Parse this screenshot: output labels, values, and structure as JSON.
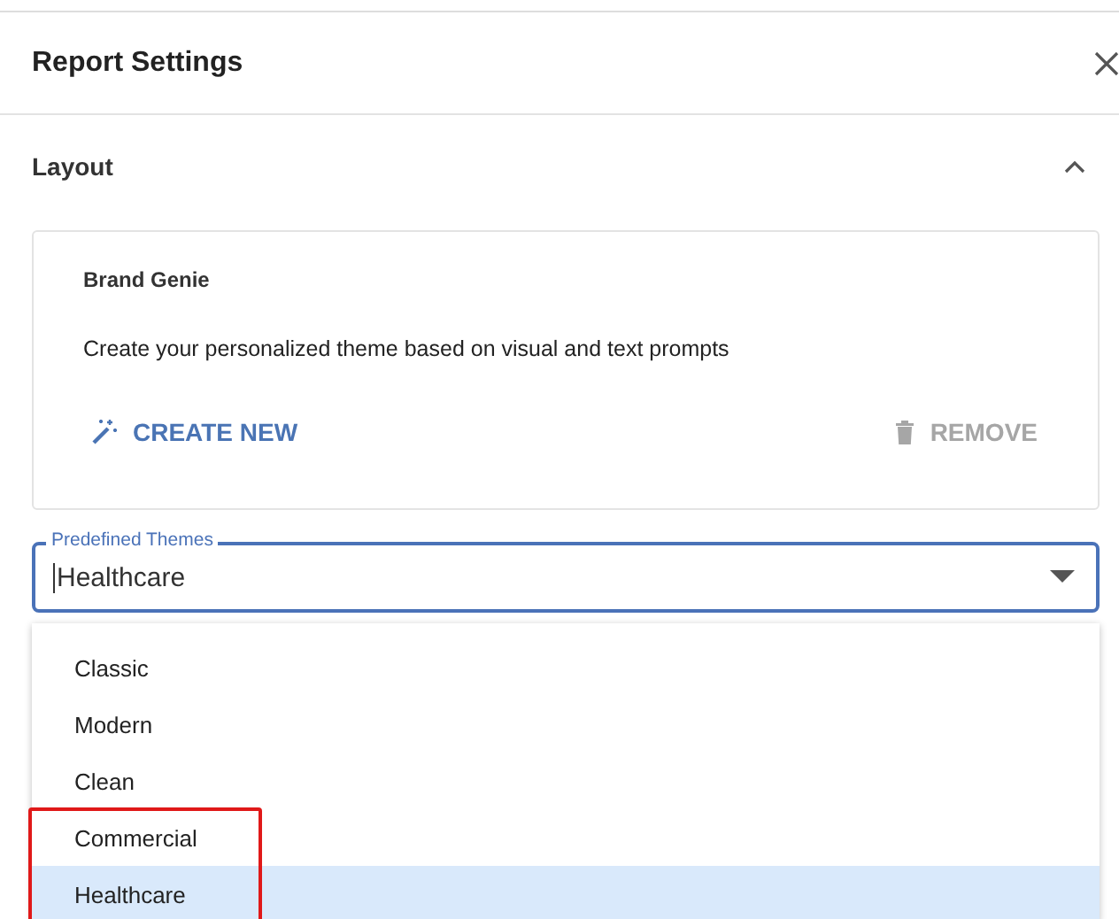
{
  "panel": {
    "title": "Report Settings"
  },
  "section": {
    "title": "Layout",
    "expanded": true
  },
  "brand_card": {
    "title": "Brand Genie",
    "description": "Create your personalized theme based on visual and text prompts",
    "create_button": "CREATE NEW",
    "remove_button": {
      "label": "REMOVE",
      "disabled": true
    }
  },
  "theme_select": {
    "label": "Predefined Themes",
    "value": "Healthcare",
    "open": true
  },
  "options": [
    {
      "label": "Classic",
      "selected": false,
      "highlighted": false
    },
    {
      "label": "Modern",
      "selected": false,
      "highlighted": false
    },
    {
      "label": "Clean",
      "selected": false,
      "highlighted": false
    },
    {
      "label": "Commercial",
      "selected": false,
      "highlighted": true
    },
    {
      "label": "Healthcare",
      "selected": true,
      "highlighted": true
    }
  ]
}
